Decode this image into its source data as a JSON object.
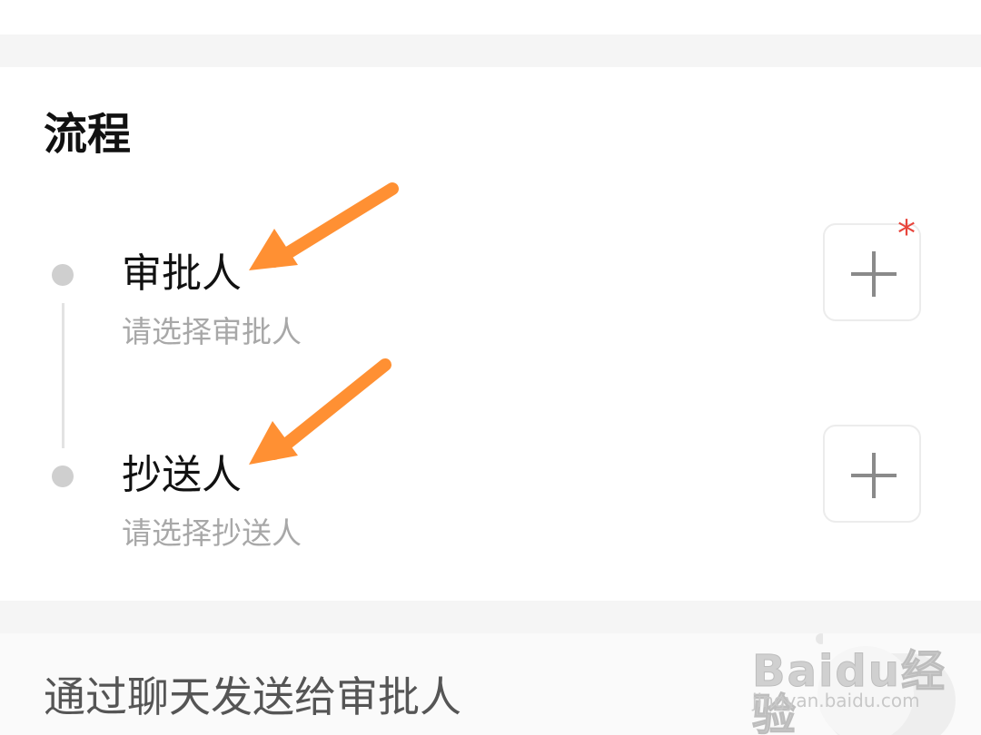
{
  "section": {
    "title": "流程"
  },
  "steps": [
    {
      "title": "审批人",
      "hint": "请选择审批人",
      "required": true,
      "required_mark": "*"
    },
    {
      "title": "抄送人",
      "hint": "请选择抄送人",
      "required": false
    }
  ],
  "send_option": {
    "label": "通过聊天发送给审批人"
  },
  "watermark": {
    "brand": "Baidu经验",
    "url": "jingyan.baidu.com"
  },
  "colors": {
    "annotation_arrow": "#ff9033",
    "required_star": "#e8453c",
    "timeline_dot": "#cfcfcf",
    "hint_text": "#a8a8a8"
  },
  "icons": {
    "add": "plus-icon",
    "annotation": "orange-arrow-icon"
  }
}
